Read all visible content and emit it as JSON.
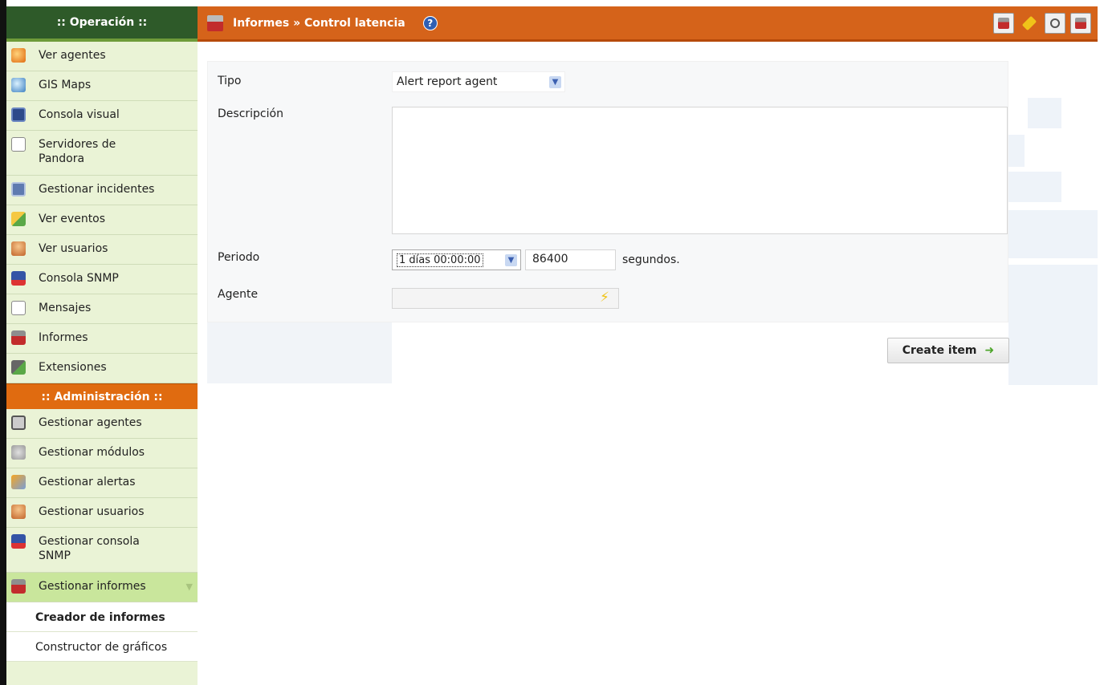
{
  "sidebar": {
    "operation_header": ":: Operación ::",
    "operation_items": [
      {
        "label": "Ver agentes",
        "icon": "agents-icon"
      },
      {
        "label": "GIS Maps",
        "icon": "globe-icon"
      },
      {
        "label": "Consola visual",
        "icon": "monitor-icon"
      },
      {
        "label": "Servidores de Pandora",
        "icon": "servers-icon"
      },
      {
        "label": "Gestionar incidentes",
        "icon": "incidents-icon"
      },
      {
        "label": "Ver eventos",
        "icon": "events-icon"
      },
      {
        "label": "Ver usuarios",
        "icon": "users-icon"
      },
      {
        "label": "Consola SNMP",
        "icon": "snmp-icon"
      },
      {
        "label": "Mensajes",
        "icon": "mail-icon"
      },
      {
        "label": "Informes",
        "icon": "reports-icon"
      },
      {
        "label": "Extensiones",
        "icon": "extensions-icon"
      }
    ],
    "admin_header": ":: Administración ::",
    "admin_items": [
      {
        "label": "Gestionar agentes",
        "icon": "manage-agents-icon"
      },
      {
        "label": "Gestionar módulos",
        "icon": "modules-icon"
      },
      {
        "label": "Gestionar alertas",
        "icon": "alerts-icon"
      },
      {
        "label": "Gestionar usuarios",
        "icon": "manage-users-icon"
      },
      {
        "label": "Gestionar consola SNMP",
        "icon": "snmp-console-icon"
      },
      {
        "label": "Gestionar informes",
        "icon": "manage-reports-icon"
      }
    ],
    "sub_items": [
      {
        "label": "Creador de informes",
        "bold": true
      },
      {
        "label": "Constructor de gráficos",
        "bold": false
      }
    ]
  },
  "header": {
    "title": "Informes » Control latencia",
    "help": "?"
  },
  "form": {
    "tipo_label": "Tipo",
    "tipo_value": "Alert report agent",
    "descripcion_label": "Descripción",
    "periodo_label": "Periodo",
    "periodo_select": "1 días 00:00:00",
    "periodo_seconds": "86400",
    "periodo_unit": "segundos.",
    "agente_label": "Agente",
    "agente_value": ""
  },
  "actions": {
    "create_label": "Create item"
  },
  "colors": {
    "header_orange": "#d5631a",
    "sidebar_green": "#eaf3d6",
    "op_header": "#2e5a29",
    "admin_header": "#e06b10"
  }
}
